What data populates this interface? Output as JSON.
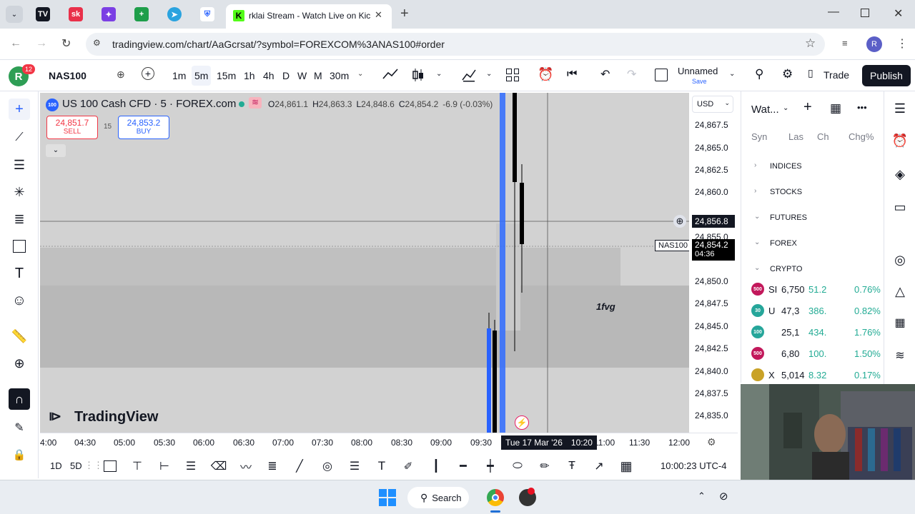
{
  "browser": {
    "tab_title": "rklai Stream - Watch Live on Kic",
    "url": "tradingview.com/chart/AaGcrsat/?symbol=FOREXCOM%3ANAS100#order",
    "profile_initial": "R",
    "tab_icons": [
      {
        "name": "tradingview-tab-icon",
        "label": "TV",
        "color": "#131722"
      },
      {
        "name": "sk-tab-icon",
        "label": "sk",
        "color": "#e9304a"
      },
      {
        "name": "colorful-app-tab-icon",
        "label": "✦",
        "color": "#7b3fe4"
      },
      {
        "name": "sheets-tab-icon",
        "label": "+",
        "color": "#1e9e4a"
      },
      {
        "name": "telegram-tab-icon",
        "label": "➤",
        "color": "#2aa3df"
      },
      {
        "name": "crypto-tab-icon",
        "label": "⛨",
        "color": "#2962ff"
      }
    ]
  },
  "toolbar": {
    "avatar_initial": "R",
    "notification_count": "12",
    "symbol": "NAS100",
    "intervals": [
      "1m",
      "5m",
      "15m",
      "1h",
      "4h",
      "D",
      "W",
      "M",
      "30m"
    ],
    "active_interval": "5m",
    "layout_name": "Unnamed",
    "save_label": "Save",
    "trade_label": "Trade",
    "publish_label": "Publish"
  },
  "legend": {
    "badge": "100",
    "title": "US 100 Cash CFD · 5 · FOREX.com",
    "o_label": "O",
    "o": "24,861.1",
    "h_label": "H",
    "h": "24,863.3",
    "l_label": "L",
    "l": "24,848.6",
    "c_label": "C",
    "c": "24,854.2",
    "change": "-6.9 (-0.03%)",
    "sell_price": "24,851.7",
    "sell_label": "SELL",
    "spread": "15",
    "buy_price": "24,853.2",
    "buy_label": "BUY"
  },
  "chart": {
    "currency": "USD",
    "annotation": "1fvg",
    "watermark": "TradingView",
    "price_labels": [
      "24,867.5",
      "24,865.0",
      "24,862.5",
      "24,860.0",
      "24,855.0",
      "24,850.0",
      "24,847.5",
      "24,845.0",
      "24,842.5",
      "24,840.0",
      "24,837.5",
      "24,835.0"
    ],
    "crosshair_price": "24,856.8",
    "last_symbol": "NAS100",
    "last_price": "24,854.2",
    "countdown": "04:36",
    "time_labels": [
      "4:00",
      "04:30",
      "05:00",
      "05:30",
      "06:00",
      "06:30",
      "07:00",
      "07:30",
      "08:00",
      "08:30",
      "09:00",
      "09:30",
      "11:00",
      "11:30",
      "12:00"
    ],
    "crosshair_date": "Tue 17 Mar '26",
    "crosshair_time": "10:20",
    "colors": {
      "up": "#2962ff",
      "down": "#000000",
      "zone": "#bdbdbd"
    }
  },
  "bottom": {
    "range1": "1D",
    "range2": "5D",
    "clock": "10:00:23 UTC-4"
  },
  "watchlist": {
    "title": "Wat...",
    "columns": [
      "Syn",
      "Las",
      "Ch",
      "Chg%"
    ],
    "sections": [
      "INDICES",
      "STOCKS",
      "FUTURES",
      "FOREX",
      "CRYPTO"
    ],
    "rows": [
      {
        "badge": "500",
        "color": "#c2185b",
        "sym": "SI",
        "last": "6,750",
        "chg": "51.2",
        "pct": "0.76%"
      },
      {
        "badge": "30",
        "color": "#26a69a",
        "sym": "U",
        "last": "47,3",
        "chg": "386.",
        "pct": "0.82%"
      },
      {
        "badge": "100",
        "color": "#26a69a",
        "sym": "",
        "last": "25,1",
        "chg": "434.",
        "pct": "1.76%"
      },
      {
        "badge": "500",
        "color": "#c2185b",
        "sym": "",
        "last": "6,80",
        "chg": "100.",
        "pct": "1.50%"
      },
      {
        "badge": "",
        "color": "#c9a227",
        "sym": "X",
        "last": "5,014",
        "chg": "8.32",
        "pct": "0.17%"
      }
    ]
  },
  "taskbar": {
    "search_label": "Search"
  }
}
